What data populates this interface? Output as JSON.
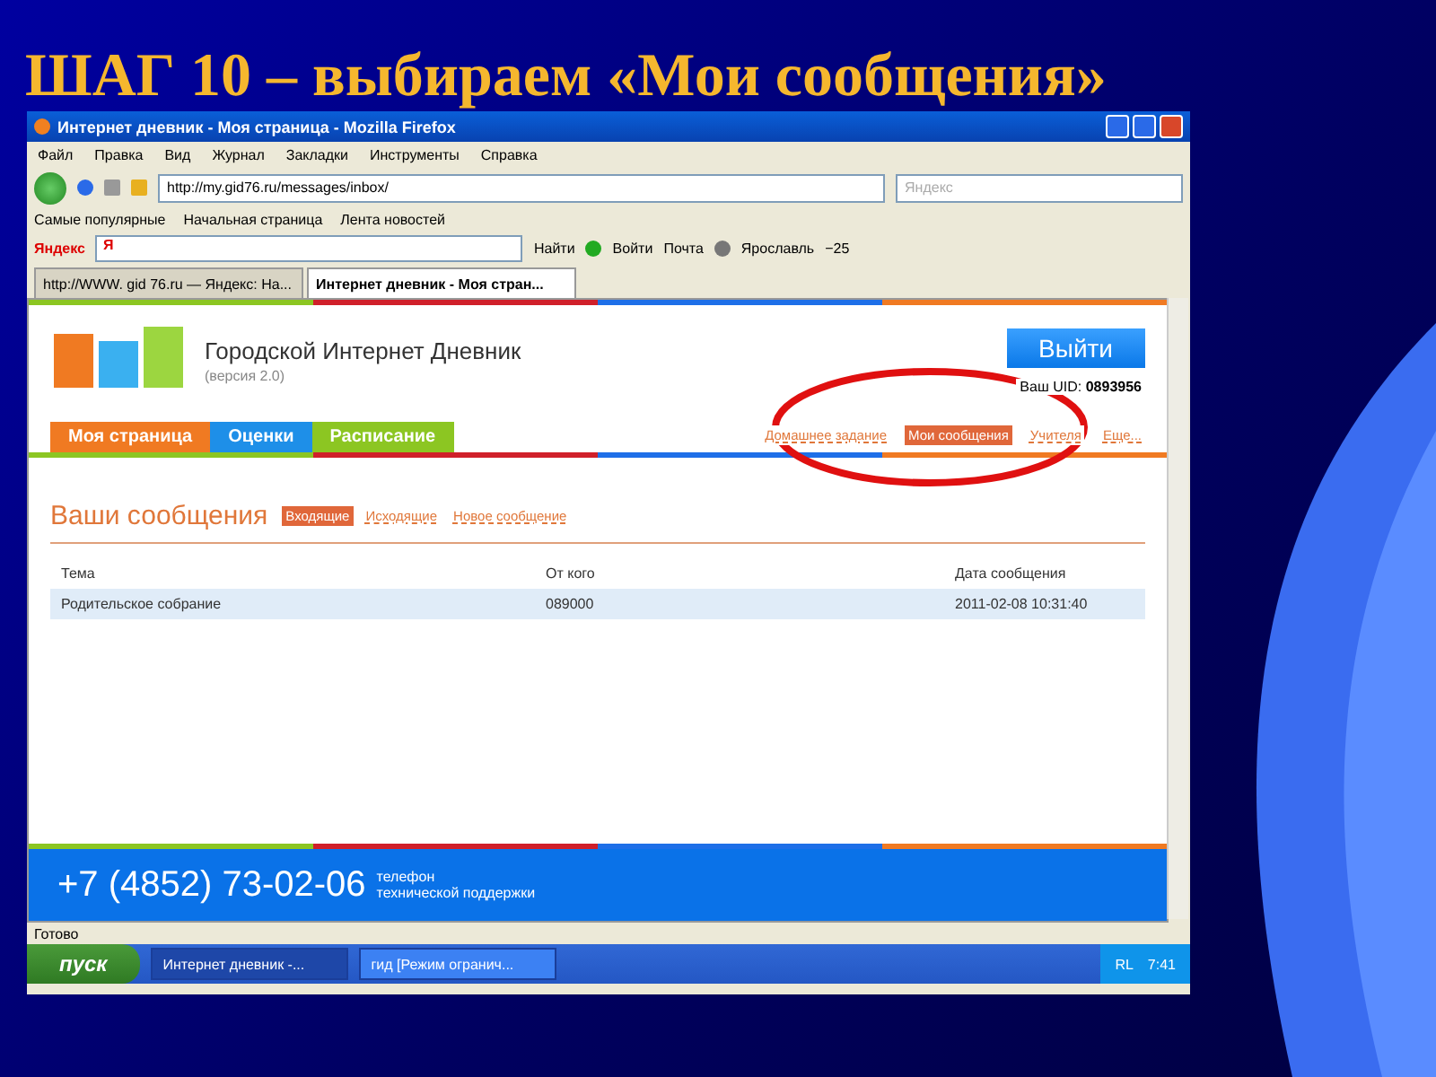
{
  "slide_title": "ШАГ 10 – выбираем «Мои сообщения»",
  "window": {
    "title": "Интернет дневник - Моя страница - Mozilla Firefox"
  },
  "menu": [
    "Файл",
    "Правка",
    "Вид",
    "Журнал",
    "Закладки",
    "Инструменты",
    "Справка"
  ],
  "address": {
    "value": "http://my.gid76.ru/messages/inbox/"
  },
  "search": {
    "placeholder": "Яндекс"
  },
  "bookmarks": [
    "Самые популярные",
    "Начальная страница",
    "Лента новостей"
  ],
  "yandex_bar": {
    "logo": "Яндекс",
    "letter": "Я",
    "find": "Найти",
    "login": "Войти",
    "mail": "Почта",
    "city": "Ярославль",
    "temperature": "−25"
  },
  "browser_tabs": [
    {
      "label": "http://WWW. gid 76.ru — Яндекс: На...",
      "selected": false
    },
    {
      "label": "Интернет дневник - Моя стран...",
      "selected": true
    }
  ],
  "site": {
    "name": "Городской Интернет Дневник",
    "version": "(версия 2.0)",
    "logout": "Выйти",
    "uid_label": "Ваш UID:",
    "uid": "0893956"
  },
  "site_tabs": [
    {
      "label": "Моя страница",
      "color": "#f07a22"
    },
    {
      "label": "Оценки",
      "color": "#1e8fe8"
    },
    {
      "label": "Расписание",
      "color": "#8cc622"
    }
  ],
  "site_links": [
    {
      "label": "Домашнее задание",
      "selected": false
    },
    {
      "label": "Мои сообщения",
      "selected": true
    },
    {
      "label": "Учителя",
      "selected": false
    },
    {
      "label": "Еще...",
      "selected": false
    }
  ],
  "messages": {
    "title": "Ваши сообщения",
    "folders": [
      {
        "label": "Входящие",
        "selected": true
      },
      {
        "label": "Исходящие",
        "selected": false
      },
      {
        "label": "Новое сообщение",
        "selected": false
      }
    ],
    "columns": [
      "Тема",
      "От кого",
      "Дата сообщения"
    ],
    "rows": [
      [
        "Родительское собрание",
        "089000",
        "2011-02-08 10:31:40"
      ]
    ]
  },
  "footer": {
    "phone": "+7 (4852) 73-02-06",
    "caption": [
      "телефон",
      "технической поддержки"
    ]
  },
  "status_bar": "Готово",
  "taskbar": {
    "start": "пуск",
    "tasks": [
      {
        "label": "Интернет дневник -...",
        "selected": true
      },
      {
        "label": "гид [Режим огранич...",
        "selected": false
      }
    ],
    "lang": "RL",
    "clock": "7:41"
  }
}
